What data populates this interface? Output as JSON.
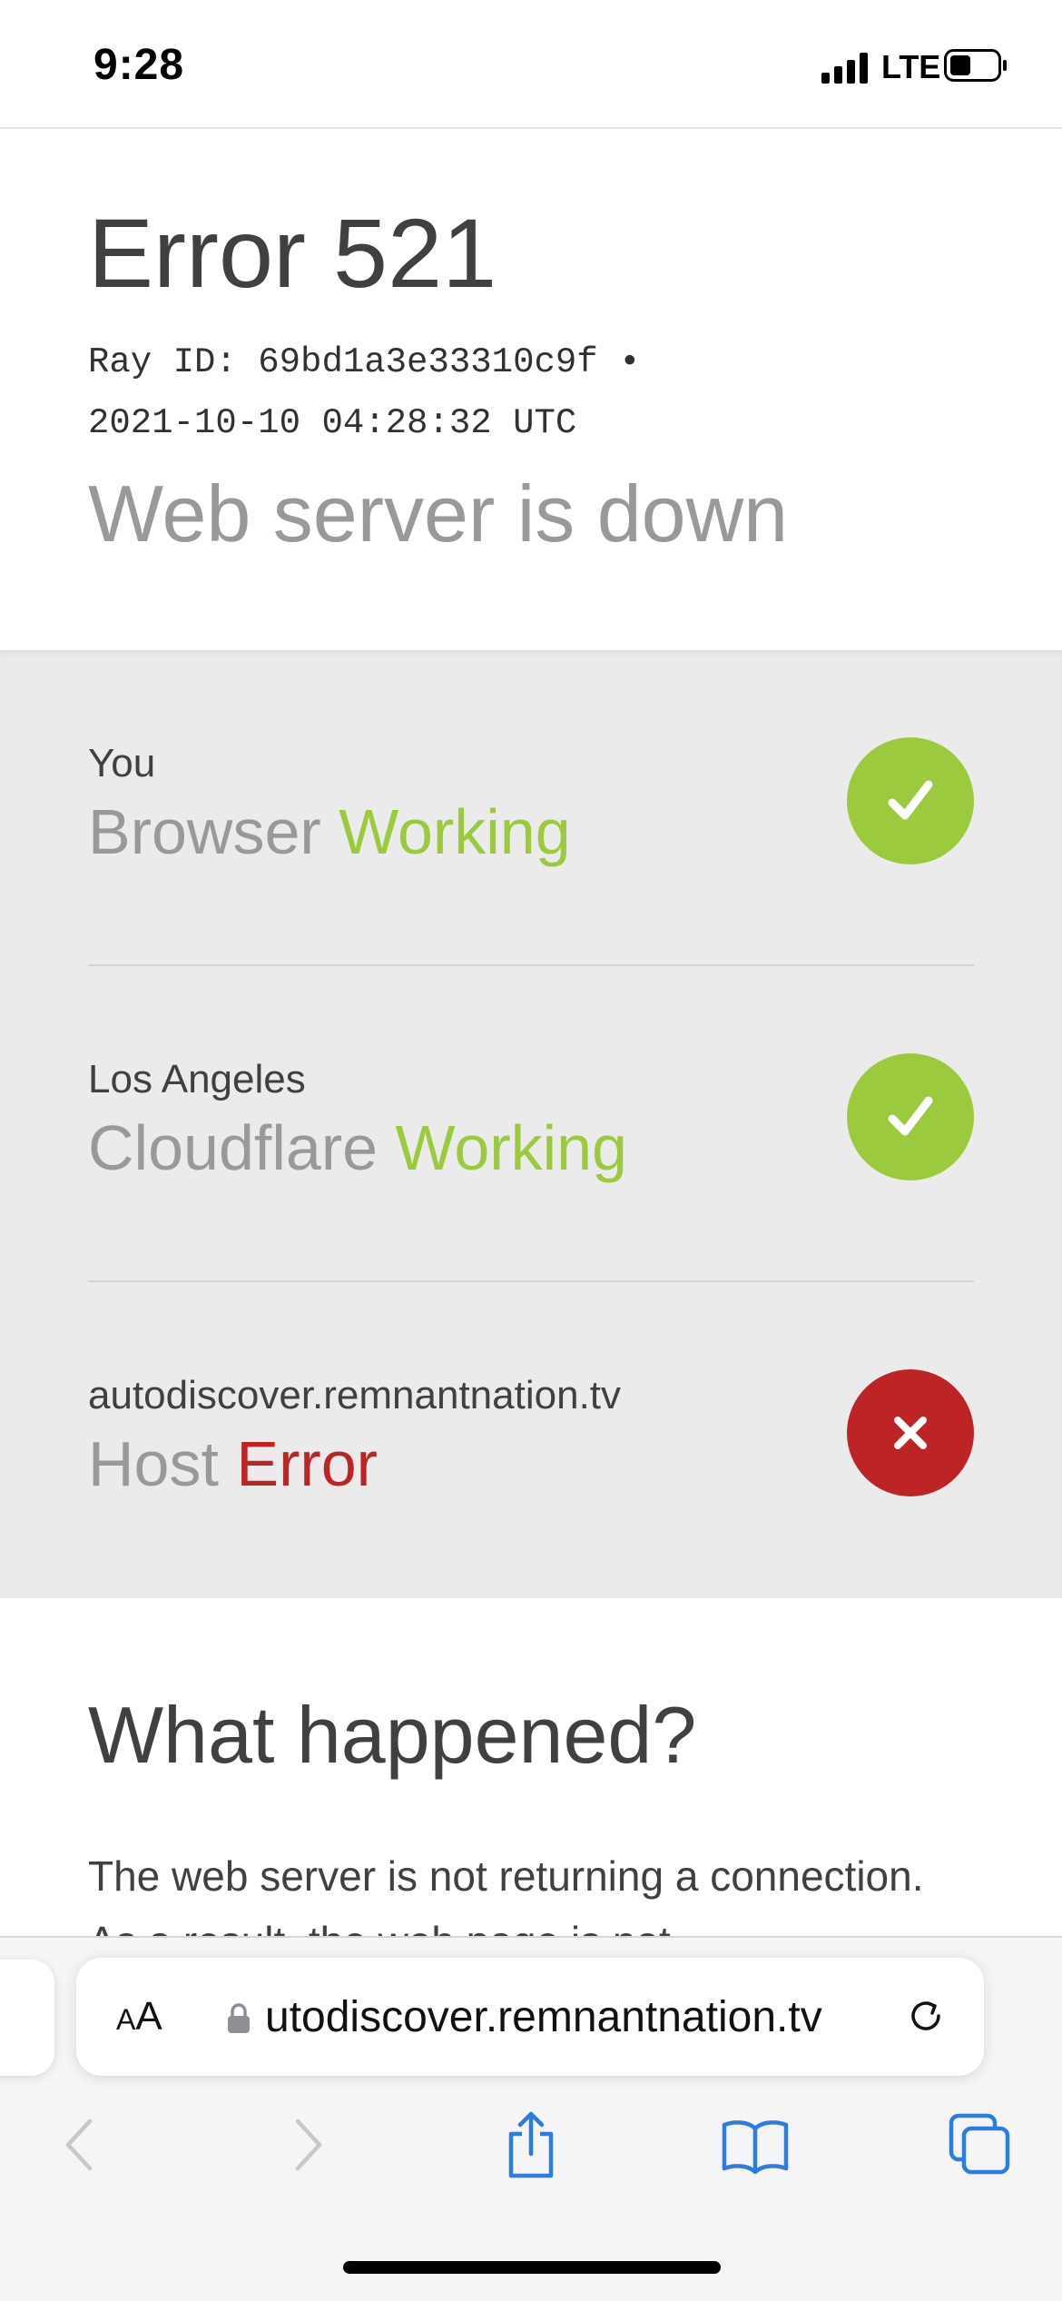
{
  "status_bar": {
    "time": "9:28",
    "network": "LTE",
    "icons": [
      "signal-bars-icon",
      "battery-icon"
    ]
  },
  "page": {
    "error_code": "Error 521",
    "ray_id_line": "Ray ID: 69bd1a3e33310c9f •",
    "timestamp_line": "2021-10-10 04:28:32 UTC",
    "subheading": "Web server is down",
    "status_rows": [
      {
        "location": "You",
        "name": "Browser",
        "status": "Working",
        "state": "ok",
        "icon": "checkmark-icon"
      },
      {
        "location": "Los Angeles",
        "name": "Cloudflare",
        "status": "Working",
        "state": "ok",
        "icon": "checkmark-icon"
      },
      {
        "location": "autodiscover.remnantnation.tv",
        "name": "Host",
        "status": "Error",
        "state": "error",
        "icon": "x-icon"
      }
    ],
    "what_happened_title": "What happened?",
    "what_happened_text": "The web server is not returning a connection. As a result, the web page is not"
  },
  "browser": {
    "aa_label_small": "A",
    "aa_label_large": "A",
    "url": "utodiscover.remnantnation.tv",
    "toolbar_icons": [
      "back-icon",
      "forward-icon",
      "share-icon",
      "bookmarks-icon",
      "tabs-icon"
    ]
  },
  "colors": {
    "working": "#9bca3e",
    "error": "#bd2426",
    "accent": "#2b7de1",
    "panel_bg": "#ebebeb"
  }
}
